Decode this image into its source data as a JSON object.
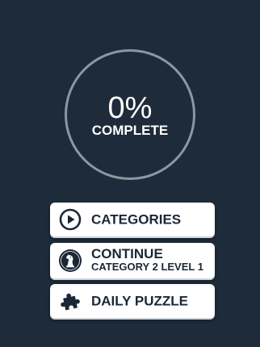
{
  "progress": {
    "percent_text": "0%",
    "label": "COMPLETE",
    "value": 0
  },
  "menu": {
    "categories_label": "CATEGORIES",
    "continue_label": "CONTINUE",
    "continue_detail": "CATEGORY 2 LEVEL 1",
    "daily_label": "DAILY PUZZLE"
  },
  "icons": {
    "categories": "play-circle-icon",
    "continue": "chess-knight-icon",
    "daily": "puzzle-piece-icon"
  },
  "colors": {
    "background": "#1e2b3a",
    "ring": "#8e97a0",
    "button": "#ffffff",
    "text_dark": "#1b2736"
  }
}
